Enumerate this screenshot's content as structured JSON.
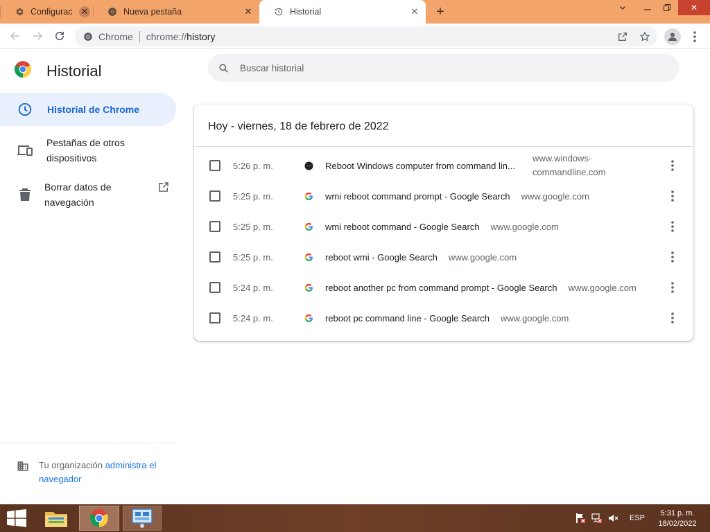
{
  "tabs": [
    {
      "title": "Configurac",
      "icon": "gear-icon",
      "active": false
    },
    {
      "title": "Nueva pestaña",
      "icon": "chrome-icon",
      "active": false
    },
    {
      "title": "Historial",
      "icon": "history-icon",
      "active": true
    }
  ],
  "omnibox": {
    "site_label": "Chrome",
    "url_scheme": "chrome://",
    "url_host": "history"
  },
  "page": {
    "title": "Historial",
    "search_placeholder": "Buscar historial"
  },
  "sidebar": {
    "items": [
      {
        "label": "Historial de Chrome",
        "icon": "clock-icon",
        "active": true
      },
      {
        "label": "Pestañas de otros dispositivos",
        "icon": "devices-icon",
        "active": false
      },
      {
        "label": "Borrar datos de navegación",
        "icon": "trash-icon",
        "active": false
      }
    ]
  },
  "org_notice": {
    "text": "Tu organización",
    "link": "administra el navegador"
  },
  "history": {
    "date_heading": "Hoy - viernes, 18 de febrero de 2022",
    "entries": [
      {
        "time": "5:26 p. m.",
        "title": "Reboot Windows computer from command lin...",
        "domain": "www.windows-commandline.com",
        "favicon": "windows-commandline-favicon"
      },
      {
        "time": "5:25 p. m.",
        "title": "wmi reboot command prompt - Google Search",
        "domain": "www.google.com",
        "favicon": "google-icon"
      },
      {
        "time": "5:25 p. m.",
        "title": "wmi reboot command - Google Search",
        "domain": "www.google.com",
        "favicon": "google-icon"
      },
      {
        "time": "5:25 p. m.",
        "title": "reboot wmi - Google Search",
        "domain": "www.google.com",
        "favicon": "google-icon"
      },
      {
        "time": "5:24 p. m.",
        "title": "reboot another pc from command prompt - Google Search",
        "domain": "www.google.com",
        "favicon": "google-icon"
      },
      {
        "time": "5:24 p. m.",
        "title": "reboot pc command line - Google Search",
        "domain": "www.google.com",
        "favicon": "google-icon"
      }
    ]
  },
  "taskbar": {
    "language": "ESP",
    "time": "5:31 p. m.",
    "date": "18/02/2022"
  },
  "colors": {
    "tabstrip": "#f3a46b",
    "accent": "#1a73e8",
    "active_nav_bg": "#e8f0fe",
    "taskbar": "#5a3320"
  }
}
